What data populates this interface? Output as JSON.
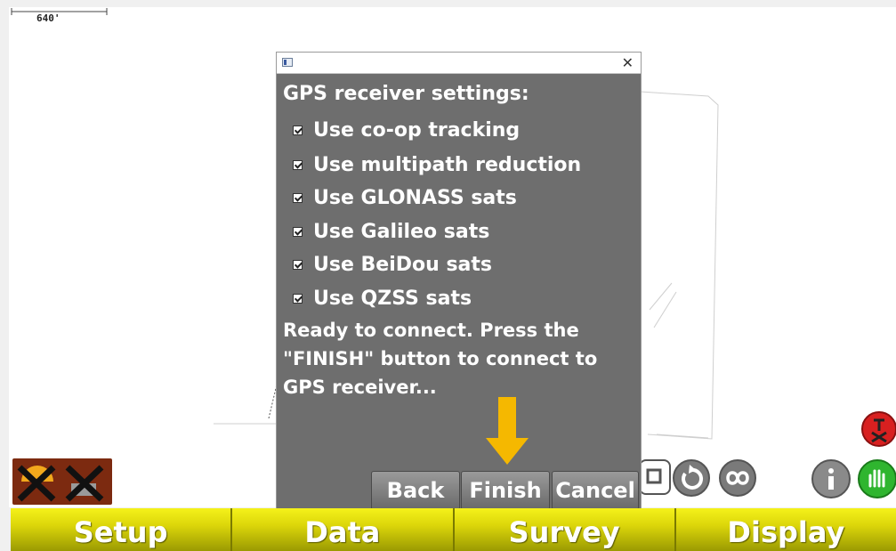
{
  "map": {
    "scale_label": "640'"
  },
  "dialog": {
    "heading": "GPS receiver settings:",
    "options": [
      {
        "label": "Use co-op tracking",
        "checked": true
      },
      {
        "label": "Use multipath reduction",
        "checked": true
      },
      {
        "label": "Use GLONASS sats",
        "checked": true
      },
      {
        "label": "Use Galileo sats",
        "checked": true
      },
      {
        "label": "Use BeiDou sats",
        "checked": true
      },
      {
        "label": "Use QZSS sats",
        "checked": true
      }
    ],
    "message": "Ready to connect. Press the\n\"FINISH\" button to connect to\nGPS receiver...",
    "buttons": {
      "back": "Back",
      "finish": "Finish",
      "cancel": "Cancel"
    },
    "close_icon": "close-icon"
  },
  "bottom_tabs": [
    {
      "label": "Setup"
    },
    {
      "label": "Data"
    },
    {
      "label": "Survey"
    },
    {
      "label": "Display"
    }
  ],
  "colors": {
    "dialog_bg": "#6e6e6e",
    "tab_yellow": "#dcd60a",
    "arrow": "#f5b800",
    "status_red": "#7c2a10"
  }
}
